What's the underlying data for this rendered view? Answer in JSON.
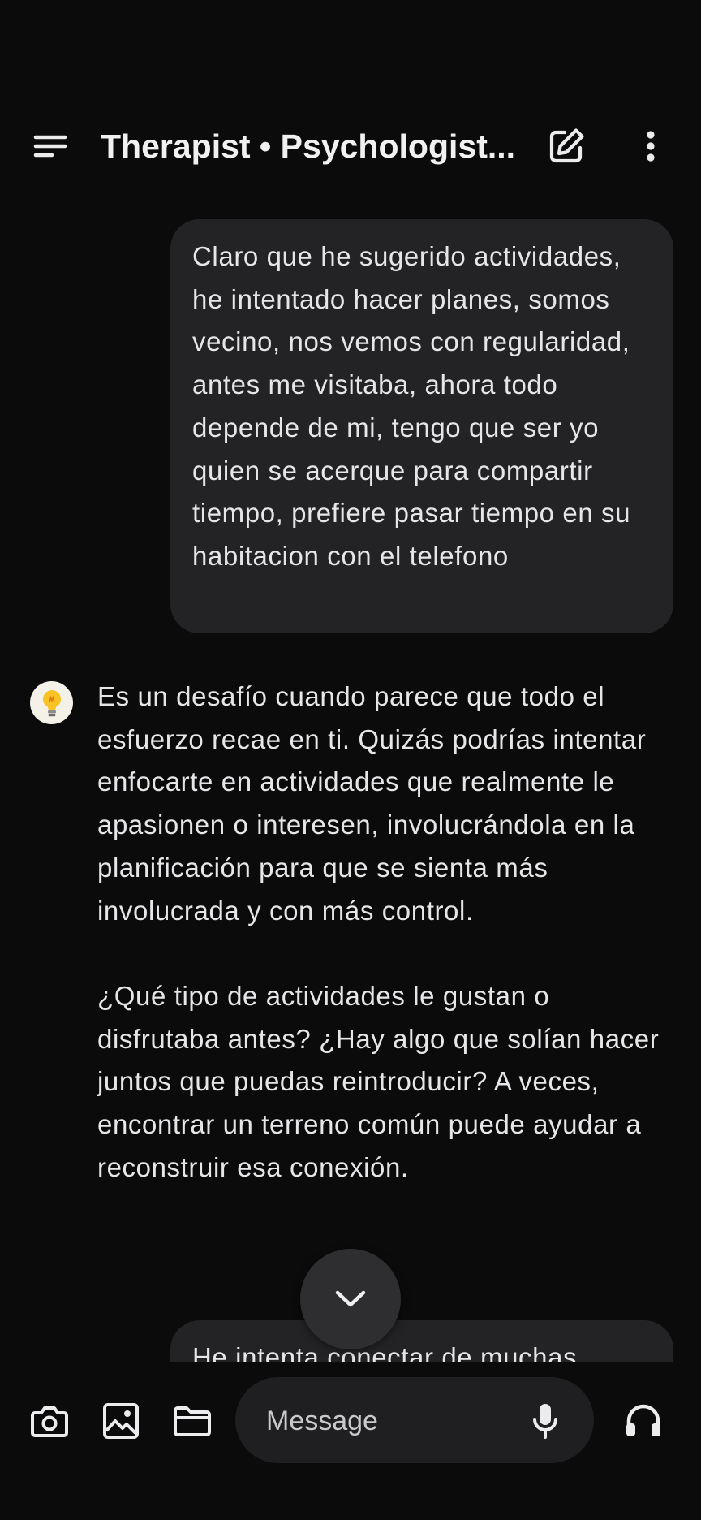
{
  "header": {
    "title": "Therapist • Psychologist...",
    "menu_icon": "menu-icon",
    "edit_icon": "edit-icon",
    "more_icon": "more-vert-icon"
  },
  "messages": [
    {
      "role": "user",
      "text": "Claro que he sugerido actividades, he intentado hacer planes, somos vecino, nos vemos con regularidad, antes me visitaba, ahora todo depende de mi, tengo que ser yo quien se acerque para compartir tiempo, prefiere pasar tiempo en su habitacion con el telefono"
    },
    {
      "role": "bot",
      "avatar_icon": "lightbulb-icon",
      "paragraphs": [
        "Es un desafío cuando parece que todo el esfuerzo recae en ti. Quizás podrías intentar enfocarte en actividades que realmente le apasionen o interesen, involucrándola en la planificación para que se sienta más involucrada y con más control.",
        "¿Qué tipo de actividades le gustan o disfrutaba antes? ¿Hay algo que solían hacer juntos que puedas reintroducir? A veces, encontrar un terreno común puede ayudar a reconstruir esa conexión."
      ]
    },
    {
      "role": "user",
      "text": "He intenta conectar de muchas"
    }
  ],
  "scroll_button_icon": "chevron-down-icon",
  "composer": {
    "placeholder": "Message",
    "camera_icon": "camera-icon",
    "gallery_icon": "image-icon",
    "folder_icon": "folder-icon",
    "mic_icon": "mic-icon",
    "headphones_icon": "headphones-icon"
  },
  "colors": {
    "background": "#0b0b0c",
    "user_bubble": "#232326",
    "input_pill": "#1f1f22",
    "text": "#e6e6e8"
  }
}
